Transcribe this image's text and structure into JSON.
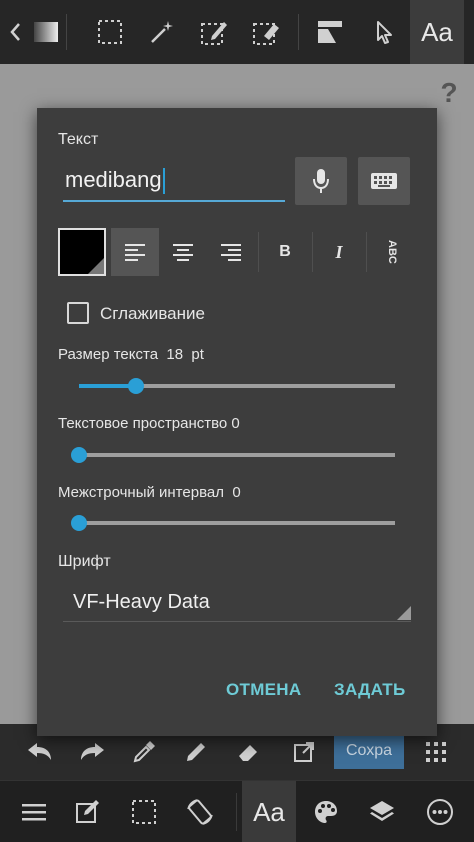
{
  "topbar": {
    "tools": [
      {
        "icon": "back-arrow-icon"
      },
      {
        "icon": "layer-swatch-icon"
      },
      {
        "icon": "rect-select-icon"
      },
      {
        "icon": "magic-wand-icon"
      },
      {
        "icon": "select-pen-icon"
      },
      {
        "icon": "select-eraser-icon"
      },
      {
        "icon": "transform-icon"
      },
      {
        "icon": "pointer-icon"
      }
    ],
    "text_tool_label": "Aa"
  },
  "canvas": {
    "help_label": "?"
  },
  "dialog": {
    "text_label": "Текст",
    "text_value": "medibang",
    "antialias_label": "Сглаживание",
    "antialias_checked": false,
    "size_label": "Размер текста",
    "size_value": "18",
    "size_unit": "pt",
    "size_fraction": 0.18,
    "spacing_label": "Текстовое пространство",
    "spacing_value": "0",
    "spacing_fraction": 0,
    "line_label": "Межстрочный интервал",
    "line_value": "0",
    "line_fraction": 0,
    "font_label": "Шрифт",
    "font_value": "VF-Heavy Data",
    "bold_label": "B",
    "italic_label": "I",
    "vertical_label": "ABC",
    "text_color": "#000000",
    "cancel_label": "ОТМЕНА",
    "ok_label": "ЗАДАТЬ"
  },
  "toolbar2": {
    "save_label": "Сохра"
  },
  "bottombar": {
    "text_tool_label": "Aa"
  },
  "colors": {
    "accent": "#2a9fd6",
    "action": "#6ecbd6"
  }
}
